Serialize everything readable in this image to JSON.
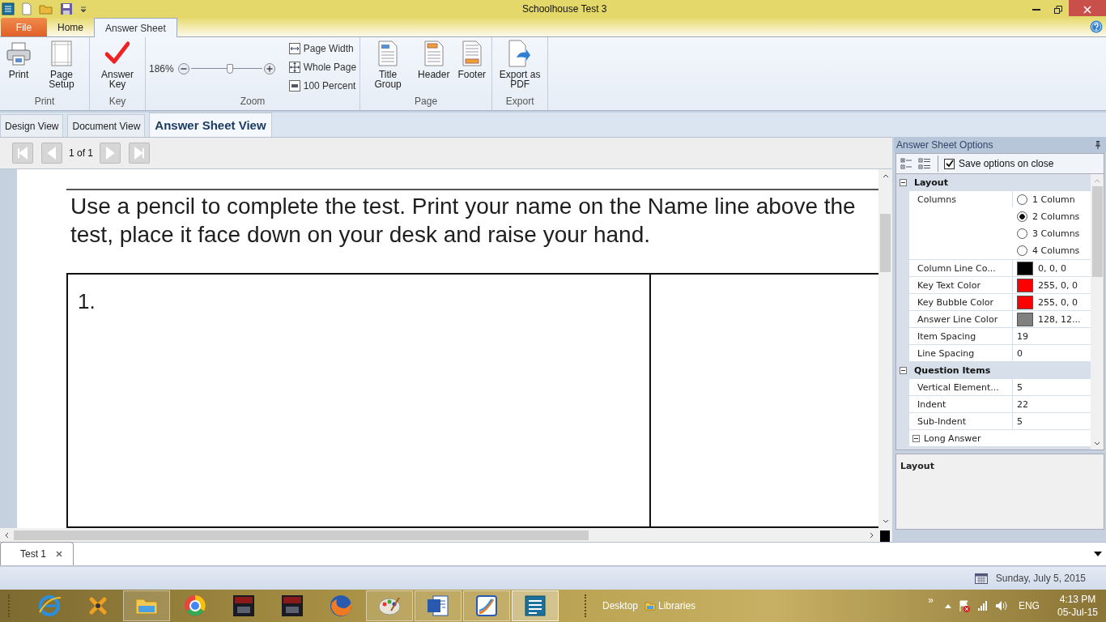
{
  "window": {
    "title": "Schoolhouse Test 3"
  },
  "ribbon": {
    "tabs": [
      {
        "label": "File",
        "kind": "file",
        "selected": false
      },
      {
        "label": "Home",
        "kind": "tab",
        "selected": false
      },
      {
        "label": "Answer Sheet",
        "kind": "tab",
        "selected": true
      }
    ],
    "groups": [
      {
        "label": "Print",
        "items": [
          {
            "kind": "printer",
            "label": "Print"
          },
          {
            "kind": "page",
            "label": "Page Setup"
          }
        ]
      },
      {
        "label": "Key",
        "items": [
          {
            "kind": "check",
            "label": "Answer Key"
          }
        ]
      },
      {
        "label": "Zoom",
        "zoom": {
          "reading": "186%",
          "level": 0.55,
          "buttons": [
            {
              "kind": "width",
              "label": "Page Width"
            },
            {
              "kind": "whole",
              "label": "Whole Page"
            },
            {
              "kind": "hundred",
              "label": "100 Percent"
            }
          ]
        }
      },
      {
        "label": "Page",
        "items": [
          {
            "kind": "title",
            "label": "Title Group"
          },
          {
            "kind": "header",
            "label": "Header"
          },
          {
            "kind": "footer",
            "label": "Footer"
          }
        ]
      },
      {
        "label": "Export",
        "items": [
          {
            "kind": "export",
            "label": "Export as PDF"
          }
        ]
      }
    ]
  },
  "view_tabs": [
    {
      "label": "Design View",
      "selected": false
    },
    {
      "label": "Document View",
      "selected": false
    },
    {
      "label": "Answer Sheet View",
      "selected": true
    }
  ],
  "navigator": {
    "page": "1 of 1",
    "buttons": [
      {
        "kind": "first",
        "disabled": true
      },
      {
        "kind": "prev",
        "disabled": true
      },
      {
        "kind": "next",
        "disabled": true
      },
      {
        "kind": "last",
        "disabled": true
      }
    ]
  },
  "sheet": {
    "instructions": "Use a pencil to complete the test. Print your name on the Name line above the test, place it face down on your desk and raise your hand.",
    "items": [
      "1."
    ]
  },
  "options_panel": {
    "title": "Answer Sheet Options",
    "save_on_close": {
      "label": "Save options on close",
      "checked": true
    },
    "categories": [
      {
        "title": "Layout",
        "expanded": true,
        "rows": [
          {
            "kind": "radio",
            "name": "Columns",
            "options": [
              {
                "label": "1 Column",
                "selected": false
              },
              {
                "label": "2 Columns",
                "selected": true
              },
              {
                "label": "3 Columns",
                "selected": false
              },
              {
                "label": "4 Columns",
                "selected": false
              }
            ]
          },
          {
            "kind": "color",
            "name": "Column Line Co...",
            "color": "#000000",
            "value": "0, 0, 0"
          },
          {
            "kind": "color",
            "name": "Key Text Color",
            "color": "#ff0000",
            "value": "255, 0, 0"
          },
          {
            "kind": "color",
            "name": "Key Bubble Color",
            "color": "#ff0000",
            "value": "255, 0, 0"
          },
          {
            "kind": "color",
            "name": "Answer Line Color",
            "color": "#808080",
            "value": "128, 12..."
          },
          {
            "kind": "text",
            "name": "Item Spacing",
            "value": "19"
          },
          {
            "kind": "text",
            "name": "Line Spacing",
            "value": "0"
          }
        ]
      },
      {
        "title": "Question Items",
        "expanded": true,
        "rows": [
          {
            "kind": "text",
            "name": "Vertical Element...",
            "value": "5"
          },
          {
            "kind": "text",
            "name": "Indent",
            "value": "22"
          },
          {
            "kind": "text",
            "name": "Sub-Indent",
            "value": "5"
          },
          {
            "kind": "subcategory",
            "name": "Long Answer",
            "expanded": true
          }
        ]
      }
    ],
    "description": "Layout"
  },
  "document_tabs": [
    {
      "label": "Test 1",
      "selected": true
    }
  ],
  "status_bar": {
    "date": "Sunday, July 5, 2015"
  },
  "taskbar": {
    "apps": [
      {
        "kind": "globe",
        "open": false,
        "selected": false
      },
      {
        "kind": "tools",
        "open": false,
        "selected": false
      },
      {
        "kind": "folder",
        "open": true,
        "selected": false
      },
      {
        "kind": "ring",
        "open": false,
        "selected": false
      },
      {
        "kind": "game",
        "open": false,
        "selected": false
      },
      {
        "kind": "game",
        "open": false,
        "selected": false
      },
      {
        "kind": "fox",
        "open": false,
        "selected": false
      },
      {
        "kind": "palette",
        "open": true,
        "selected": false
      },
      {
        "kind": "doc",
        "open": true,
        "selected": false
      },
      {
        "kind": "chart",
        "open": true,
        "selected": false
      },
      {
        "kind": "list",
        "open": true,
        "selected": true
      }
    ],
    "toolbars": [
      "Desktop",
      "Libraries"
    ],
    "overflow": "»",
    "language": "ENG",
    "time": "4:13 PM",
    "date": "05-Jul-15"
  }
}
